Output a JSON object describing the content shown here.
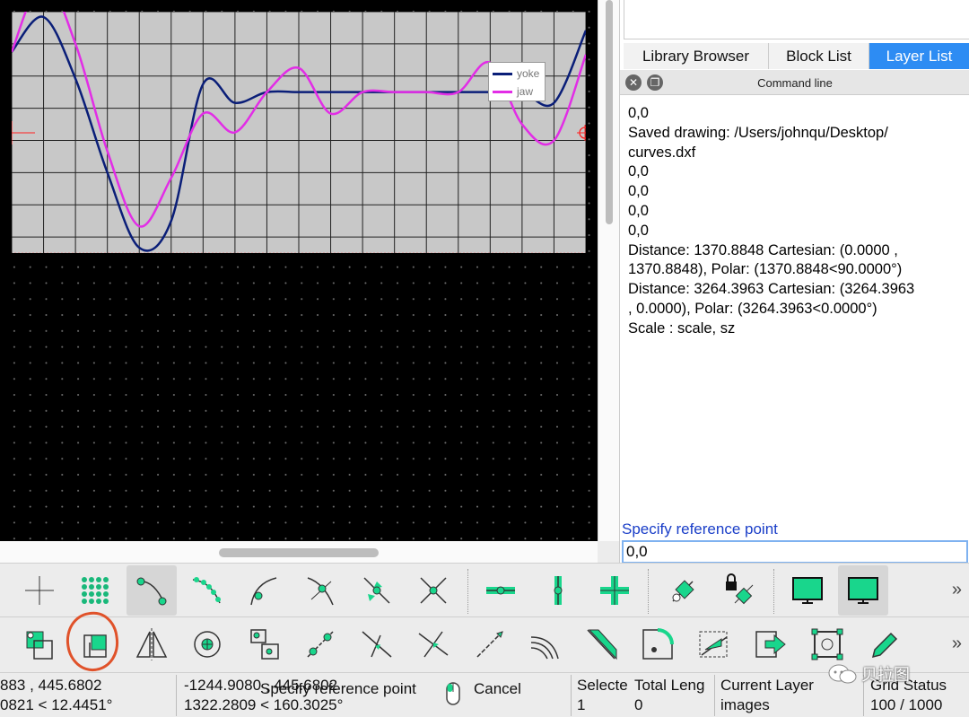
{
  "chart_data": {
    "type": "line",
    "x": [
      0,
      2,
      4,
      6,
      8,
      10,
      12,
      14,
      16,
      18,
      20,
      22,
      24,
      26,
      28,
      30,
      32,
      34,
      36
    ],
    "xlim": [
      0,
      36
    ],
    "ylim": [
      -6,
      3
    ],
    "grid": true,
    "legend_position": "top-right",
    "series": [
      {
        "name": "yoke",
        "color": "#0a1e78",
        "values": [
          1.5,
          2.8,
          0.5,
          -3.0,
          -5.8,
          -4.8,
          0.3,
          -0.4,
          0.0,
          0.0,
          0.0,
          0.0,
          0.0,
          0.0,
          0.0,
          0.0,
          0.0,
          -0.4,
          2.3
        ]
      },
      {
        "name": "jaw",
        "color": "#e22de6",
        "values": [
          1.5,
          4.2,
          1.8,
          -2.2,
          -5.0,
          -3.2,
          -0.8,
          -1.5,
          0.0,
          0.9,
          -0.8,
          0.0,
          0.0,
          0.0,
          0.0,
          1.1,
          -1.2,
          -1.8,
          1.4
        ]
      }
    ]
  },
  "dock": {
    "tabs": [
      "Library Browser",
      "Block List",
      "Layer List"
    ],
    "header_title": "Command line",
    "output_lines": [
      "0,0",
      "Saved drawing: /Users/johnqu/Desktop/",
      "curves.dxf",
      "0,0",
      "0,0",
      "0,0",
      "0,0",
      "Distance: 1370.8848 Cartesian: (0.0000 ,",
      "1370.8848), Polar: (1370.8848<90.0000°)",
      "Distance: 3264.3963 Cartesian: (3264.3963",
      ", 0.0000), Polar: (3264.3963<0.0000°)",
      "Scale : scale, sz"
    ],
    "prompt": "Specify reference point",
    "input_value": "0,0"
  },
  "toolbar_more": "»",
  "statusbar": {
    "abs_coord_1": "883 , 445.6802",
    "abs_coord_2": "0821 < 12.4451°",
    "rel_coord_1": "-1244.9080 , 445.6802",
    "rel_coord_2": "1322.2809 < 160.3025°",
    "prompt_overlay": "Specify reference point",
    "cancel": "Cancel",
    "selected_label": "Selecte",
    "selected_value": "1",
    "total_length_label": "Total Leng",
    "total_length_value": "0",
    "current_layer_label": "Current Layer",
    "current_layer_value": "images",
    "grid_status_label": "Grid Status",
    "grid_status_value": "100 / 1000"
  },
  "watermark": "贝拉图",
  "colors": {
    "accent": "#2d8cf3",
    "tool_green": "#19d68c",
    "prompt_blue": "#1a3ec8"
  }
}
